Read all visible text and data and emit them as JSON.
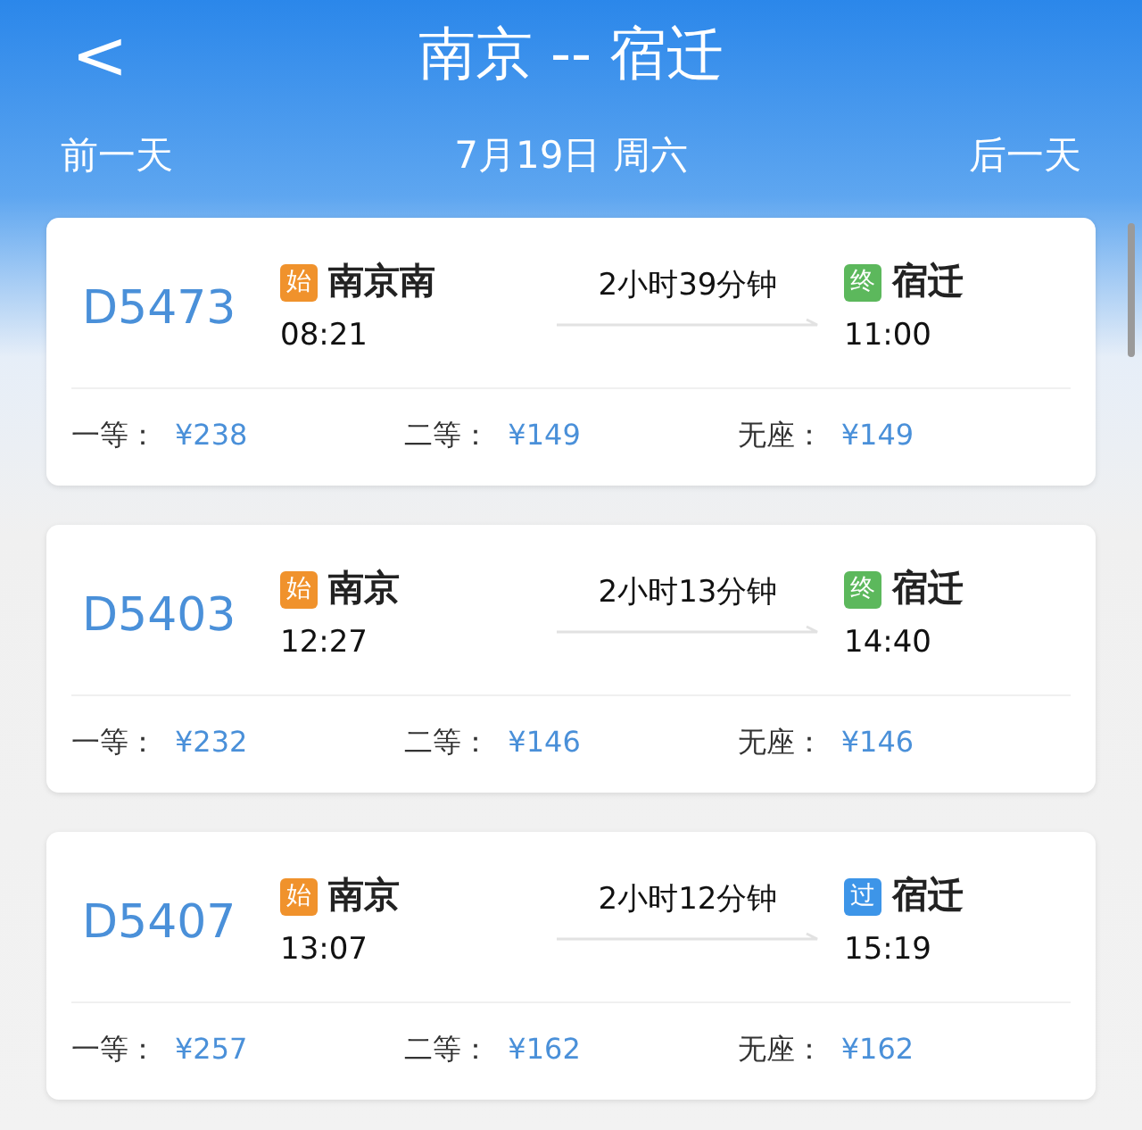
{
  "header": {
    "back": "<",
    "title": "南京 -- 宿迁",
    "prev_day": "前一天",
    "date": "7月19日 周六",
    "next_day": "后一天"
  },
  "trains": [
    {
      "number": "D5473",
      "from": {
        "badge": "始",
        "color": "#f0922c",
        "station": "南京南",
        "time": "08:21"
      },
      "duration": "2小时39分钟",
      "to": {
        "badge": "终",
        "color": "#5cb85c",
        "station": "宿迁",
        "time": "11:00"
      },
      "prices": [
        {
          "label": "一等：",
          "price": "¥238"
        },
        {
          "label": "二等：",
          "price": "¥149"
        },
        {
          "label": "无座：",
          "price": "¥149"
        }
      ]
    },
    {
      "number": "D5403",
      "from": {
        "badge": "始",
        "color": "#f0922c",
        "station": "南京",
        "time": "12:27"
      },
      "duration": "2小时13分钟",
      "to": {
        "badge": "终",
        "color": "#5cb85c",
        "station": "宿迁",
        "time": "14:40"
      },
      "prices": [
        {
          "label": "一等：",
          "price": "¥232"
        },
        {
          "label": "二等：",
          "price": "¥146"
        },
        {
          "label": "无座：",
          "price": "¥146"
        }
      ]
    },
    {
      "number": "D5407",
      "from": {
        "badge": "始",
        "color": "#f0922c",
        "station": "南京",
        "time": "13:07"
      },
      "duration": "2小时12分钟",
      "to": {
        "badge": "过",
        "color": "#3d95e8",
        "station": "宿迁",
        "time": "15:19"
      },
      "prices": [
        {
          "label": "一等：",
          "price": "¥257"
        },
        {
          "label": "二等：",
          "price": "¥162"
        },
        {
          "label": "无座：",
          "price": "¥162"
        }
      ]
    }
  ]
}
